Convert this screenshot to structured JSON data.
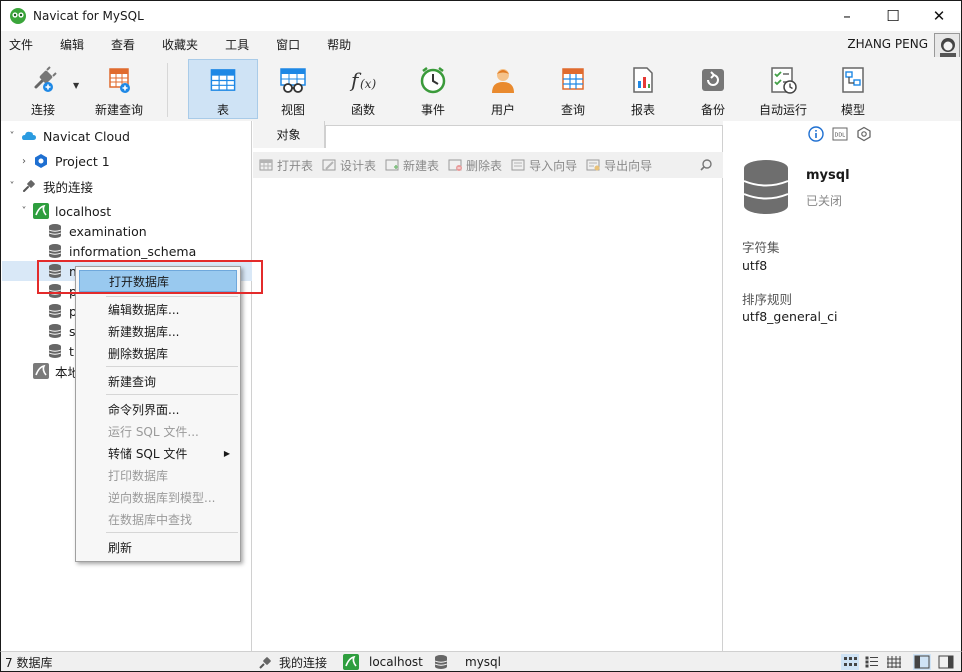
{
  "window": {
    "title": "Navicat for MySQL",
    "controls": {
      "minimize": "–",
      "maximize": "☐",
      "close": "✕"
    }
  },
  "menubar": {
    "items": [
      "文件",
      "编辑",
      "查看",
      "收藏夹",
      "工具",
      "窗口",
      "帮助"
    ],
    "user": "ZHANG PENG"
  },
  "toolbar": {
    "buttons": [
      {
        "label": "连接",
        "icon": "plug-icon"
      },
      {
        "label": "新建查询",
        "icon": "new-query-icon"
      },
      {
        "label": "表",
        "icon": "table-icon",
        "active": true
      },
      {
        "label": "视图",
        "icon": "view-icon"
      },
      {
        "label": "函数",
        "icon": "function-icon"
      },
      {
        "label": "事件",
        "icon": "clock-icon"
      },
      {
        "label": "用户",
        "icon": "user-icon"
      },
      {
        "label": "查询",
        "icon": "query-icon"
      },
      {
        "label": "报表",
        "icon": "report-icon"
      },
      {
        "label": "备份",
        "icon": "backup-icon"
      },
      {
        "label": "自动运行",
        "icon": "schedule-icon"
      },
      {
        "label": "模型",
        "icon": "model-icon"
      }
    ]
  },
  "sidebar": {
    "tree": [
      {
        "label": "Navicat Cloud",
        "icon": "cloud-icon"
      },
      {
        "label": "Project 1",
        "icon": "project-icon"
      },
      {
        "label": "我的连接",
        "icon": "connection-group-icon"
      },
      {
        "label": "localhost",
        "icon": "mysql-connection-icon"
      },
      {
        "label": "examination",
        "icon": "database-icon"
      },
      {
        "label": "information_schema",
        "icon": "database-icon"
      },
      {
        "label": "mysql",
        "icon": "database-icon",
        "selected": true
      },
      {
        "label": "p",
        "icon": "database-icon"
      },
      {
        "label": "p",
        "icon": "database-icon"
      },
      {
        "label": "s",
        "icon": "database-icon"
      },
      {
        "label": "t",
        "icon": "database-icon"
      },
      {
        "label": "本地",
        "icon": "mysql-connection-icon"
      }
    ]
  },
  "center": {
    "tab": "对象",
    "object_toolbar": [
      "打开表",
      "设计表",
      "新建表",
      "删除表",
      "导入向导",
      "导出向导"
    ]
  },
  "info": {
    "db_name": "mysql",
    "db_state": "已关闭",
    "charset_label": "字符集",
    "charset_value": "utf8",
    "collation_label": "排序规则",
    "collation_value": "utf8_general_ci"
  },
  "context_menu": {
    "items": [
      {
        "label": "打开数据库",
        "highlighted": true
      },
      {
        "label": "编辑数据库..."
      },
      {
        "label": "新建数据库..."
      },
      {
        "label": "删除数据库"
      },
      {
        "label": "新建查询"
      },
      {
        "label": "命令列界面..."
      },
      {
        "label": "运行 SQL 文件...",
        "disabled": true
      },
      {
        "label": "转储 SQL 文件",
        "submenu": true
      },
      {
        "label": "打印数据库",
        "disabled": true
      },
      {
        "label": "逆向数据库到模型...",
        "disabled": true
      },
      {
        "label": "在数据库中查找",
        "disabled": true
      },
      {
        "label": "刷新"
      }
    ]
  },
  "statusbar": {
    "count": "7 数据库",
    "connection_group": "我的连接",
    "connection": "localhost",
    "database": "mysql"
  },
  "colors": {
    "accent": "#99c9ef",
    "selection": "#d9e8f7",
    "highlight_box": "#e32b2b",
    "mysql_green": "#2e9e3e"
  }
}
